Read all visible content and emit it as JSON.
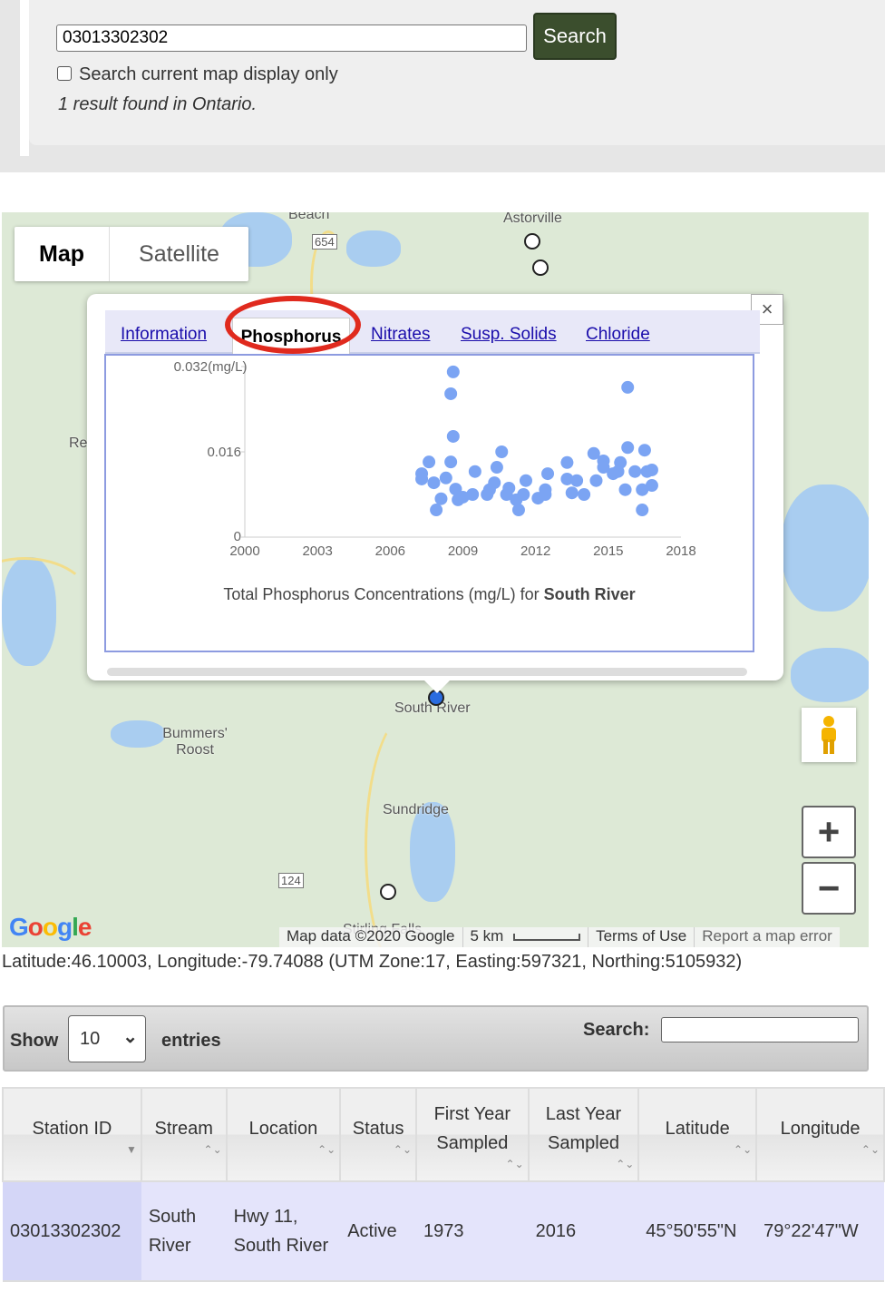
{
  "search": {
    "value": "03013302302",
    "button": "Search",
    "checkbox_label": "Search current map display only",
    "checked": false,
    "result_text": "1 result found in Ontario."
  },
  "map": {
    "type_buttons": [
      "Map",
      "Satellite"
    ],
    "labels": [
      "Beach",
      "654",
      "Astorville",
      "Re",
      "South River",
      "Bummers' Roost",
      "Sundridge",
      "124",
      "Stirling Falls"
    ],
    "zoom_in": "+",
    "zoom_out": "−",
    "logo": "Google",
    "attribution": [
      "Map data ©2020 Google",
      "5 km",
      "Terms of Use",
      "Report a map error"
    ],
    "coords": "Latitude:46.10003, Longitude:-79.74088 (UTM Zone:17, Easting:597321, Northing:5105932)"
  },
  "popup": {
    "close": "×",
    "tabs": [
      "Information",
      "Phosphorus",
      "Nitrates",
      "Susp. Solids",
      "Chloride"
    ],
    "active_tab": "Phosphorus",
    "caption_prefix": "Total Phosphorus Concentrations (mg/L) for ",
    "caption_station": "South River"
  },
  "chart_data": {
    "type": "scatter",
    "xlim": [
      2000,
      2018
    ],
    "ylim": [
      0,
      0.032
    ],
    "x_ticks": [
      "2000",
      "2003",
      "2006",
      "2009",
      "2012",
      "2015",
      "2018"
    ],
    "y_ticks": [
      "0",
      "0.016",
      "0.032(mg/L)"
    ],
    "color": "#7ba4f3",
    "points": [
      [
        2008.6,
        0.031
      ],
      [
        2008.5,
        0.0269
      ],
      [
        2008.6,
        0.0189
      ],
      [
        2007.6,
        0.0141
      ],
      [
        2007.3,
        0.0119
      ],
      [
        2007.3,
        0.0109
      ],
      [
        2007.8,
        0.0102
      ],
      [
        2007.9,
        0.0051
      ],
      [
        2008.5,
        0.0141
      ],
      [
        2008.3,
        0.0111
      ],
      [
        2008.7,
        0.009
      ],
      [
        2008.8,
        0.007
      ],
      [
        2009.4,
        0.008
      ],
      [
        2009.5,
        0.0123
      ],
      [
        2010.0,
        0.008
      ],
      [
        2010.3,
        0.0102
      ],
      [
        2010.6,
        0.016
      ],
      [
        2010.4,
        0.0131
      ],
      [
        2010.8,
        0.008
      ],
      [
        2011.2,
        0.007
      ],
      [
        2011.3,
        0.0051
      ],
      [
        2011.6,
        0.0106
      ],
      [
        2011.5,
        0.008
      ],
      [
        2012.1,
        0.0073
      ],
      [
        2012.5,
        0.0119
      ],
      [
        2012.4,
        0.0089
      ],
      [
        2013.3,
        0.014
      ],
      [
        2013.3,
        0.0109
      ],
      [
        2013.7,
        0.0106
      ],
      [
        2014.0,
        0.008
      ],
      [
        2014.4,
        0.0157
      ],
      [
        2014.5,
        0.0106
      ],
      [
        2014.8,
        0.0143
      ],
      [
        2014.8,
        0.0131
      ],
      [
        2015.4,
        0.0123
      ],
      [
        2015.5,
        0.014
      ],
      [
        2015.7,
        0.0089
      ],
      [
        2015.8,
        0.0168
      ],
      [
        2015.8,
        0.0281
      ],
      [
        2016.5,
        0.0163
      ],
      [
        2016.6,
        0.0123
      ],
      [
        2016.4,
        0.0089
      ],
      [
        2016.4,
        0.0051
      ],
      [
        2016.8,
        0.0126
      ],
      [
        2016.8,
        0.0097
      ],
      [
        2009.0,
        0.0075
      ],
      [
        2008.1,
        0.0072
      ],
      [
        2010.1,
        0.0089
      ],
      [
        2010.9,
        0.0092
      ],
      [
        2012.4,
        0.008
      ],
      [
        2013.5,
        0.0083
      ],
      [
        2015.2,
        0.0119
      ],
      [
        2016.1,
        0.0123
      ]
    ]
  },
  "table": {
    "show": "Show",
    "entries_value": "10",
    "entries": "entries",
    "search_label": "Search:",
    "columns": [
      "Station ID",
      "Stream",
      "Location",
      "Status",
      "First Year Sampled",
      "Last Year Sampled",
      "Latitude",
      "Longitude"
    ],
    "rows": [
      [
        "03013302302",
        "South River",
        "Hwy 11, South River",
        "Active",
        "1973",
        "2016",
        "45°50'55\"N",
        "79°22'47\"W"
      ]
    ]
  }
}
